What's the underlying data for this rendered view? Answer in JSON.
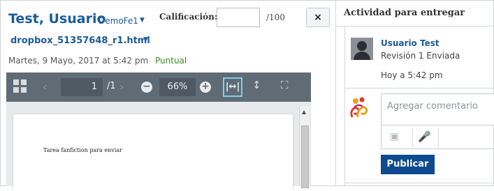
{
  "submission": {
    "student_name": "Test, Usuario",
    "org_unit": "DemoFe1",
    "file_name": "dropbox_51357648_r1.html",
    "date": "Martes, 9 Mayo, 2017 at 5:42 pm",
    "status": "Puntual"
  },
  "grading": {
    "label": "Calificación:",
    "value": "",
    "max": "/100",
    "close_label": "×"
  },
  "viewer": {
    "current_page": "1",
    "total_pages": "/1",
    "zoom": "66%",
    "zoom_out": "−",
    "zoom_in": "+",
    "fit_width": "|↔|",
    "fit_page": "↕",
    "full_screen": "⛶",
    "prev": "‹",
    "next": "›",
    "document_text": "Tarea fanfiction para enviar"
  },
  "activity": {
    "heading": "Actividad para entregar",
    "user_name": "Usuario Test",
    "revision": "Revisión 1 Enviada",
    "time": "Hoy a 5:42 pm",
    "comment_placeholder": "Agregar comentario",
    "publish_label": "Publicar"
  },
  "colors": {
    "link_blue": "#1c5b9a",
    "on_time_green": "#3a8a1f",
    "toolbar_gray": "#5f6b75",
    "publish_blue": "#0d4a8f",
    "fit_active": "#7fd0e6"
  }
}
